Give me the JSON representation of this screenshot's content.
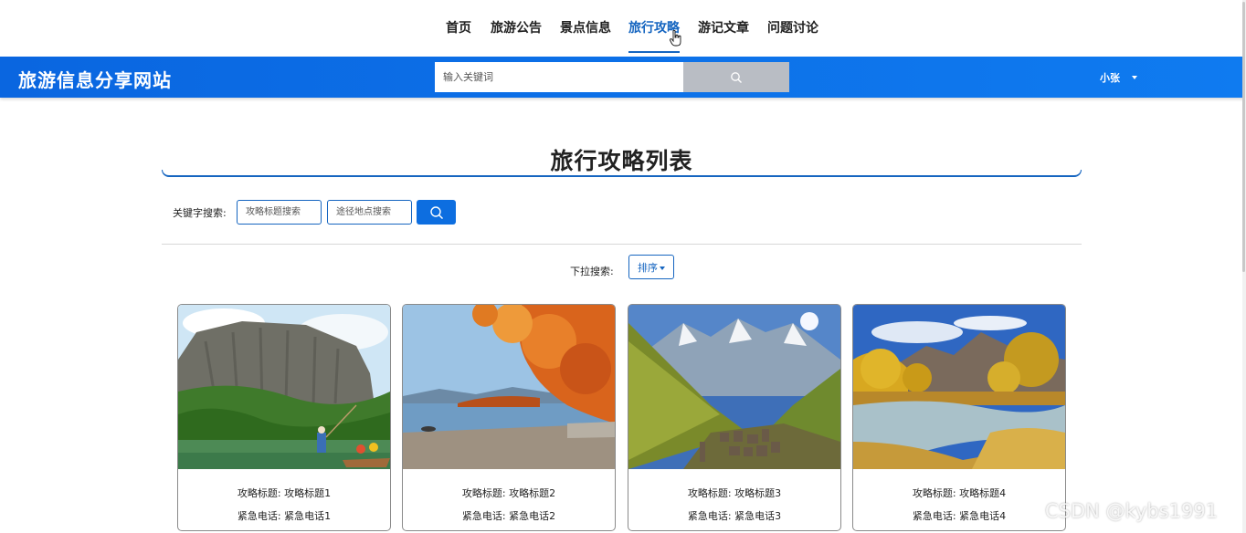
{
  "nav": {
    "items": [
      {
        "label": "首页"
      },
      {
        "label": "旅游公告"
      },
      {
        "label": "景点信息"
      },
      {
        "label": "旅行攻略"
      },
      {
        "label": "游记文章"
      },
      {
        "label": "问题讨论"
      }
    ],
    "active": "旅行攻略"
  },
  "header": {
    "site_title": "旅游信息分享网站",
    "search_placeholder": "输入关键词",
    "user_name": "小张"
  },
  "page": {
    "title": "旅行攻略列表",
    "keyword_label": "关键字搜索:",
    "title_search_placeholder": "攻略标题搜索",
    "place_search_placeholder": "途径地点搜索",
    "dropdown_label": "下拉搜索:",
    "sort_label": "排序"
  },
  "cards": [
    {
      "title_line": "攻略标题: 攻略标题1",
      "phone_line": "紧急电话: 紧急电话1"
    },
    {
      "title_line": "攻略标题: 攻略标题2",
      "phone_line": "紧急电话: 紧急电话2"
    },
    {
      "title_line": "攻略标题: 攻略标题3",
      "phone_line": "紧急电话: 紧急电话3"
    },
    {
      "title_line": "攻略标题: 攻略标题4",
      "phone_line": "紧急电话: 紧急电话4"
    }
  ],
  "watermark": "CSDN @kybs1991",
  "colors": {
    "accent": "#1565c0",
    "header_blue": "#0f7bf0",
    "search_button": "#b9bdc4"
  }
}
